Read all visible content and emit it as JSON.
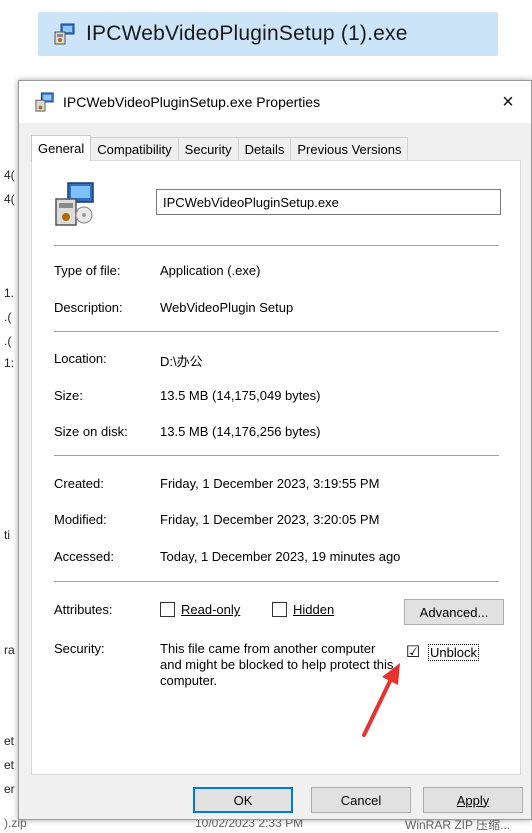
{
  "banner": {
    "filename": "IPCWebVideoPluginSetup (1).exe"
  },
  "dialog": {
    "title": "IPCWebVideoPluginSetup.exe Properties",
    "close": "×",
    "tabs": [
      "General",
      "Compatibility",
      "Security",
      "Details",
      "Previous Versions"
    ],
    "active_tab": "General",
    "filename_value": "IPCWebVideoPluginSetup.exe",
    "fields": {
      "type_label": "Type of file:",
      "type_value": "Application (.exe)",
      "desc_label": "Description:",
      "desc_value": "WebVideoPlugin Setup",
      "location_label": "Location:",
      "location_value": "D:\\办公",
      "size_label": "Size:",
      "size_value": "13.5 MB (14,175,049 bytes)",
      "disk_label": "Size on disk:",
      "disk_value": "13.5 MB (14,176,256 bytes)",
      "created_label": "Created:",
      "created_value": "Friday, 1 December 2023, 3:19:55 PM",
      "modified_label": "Modified:",
      "modified_value": "Friday, 1 December 2023, 3:20:05 PM",
      "accessed_label": "Accessed:",
      "accessed_value": "Today, 1 December 2023, 19 minutes ago",
      "attributes_label": "Attributes:",
      "readonly_label": "Read-only",
      "hidden_label": "Hidden",
      "advanced_label": "Advanced...",
      "security_label": "Security:",
      "security_text": "This file came from another computer and might be blocked to help protect this computer.",
      "unblock_label": "Unblock",
      "unblock_checked": "☑"
    },
    "buttons": {
      "ok": "OK",
      "cancel": "Cancel",
      "apply": "Apply"
    }
  },
  "background": {
    "left_fragments": [
      "4(",
      "4(",
      "1.",
      ".(",
      ".(",
      "1:",
      "ti",
      "ra",
      "et",
      "et",
      "er"
    ],
    "bottom_left": ").zip",
    "bottom_mid": "10/02/2023 2:33 PM",
    "bottom_right": "WinRAR ZIP 压缩..."
  },
  "colors": {
    "banner": "#cce4f7",
    "dialog": "#f0f0f0",
    "accent": "#0078d7",
    "arrow": "#e8322d"
  }
}
